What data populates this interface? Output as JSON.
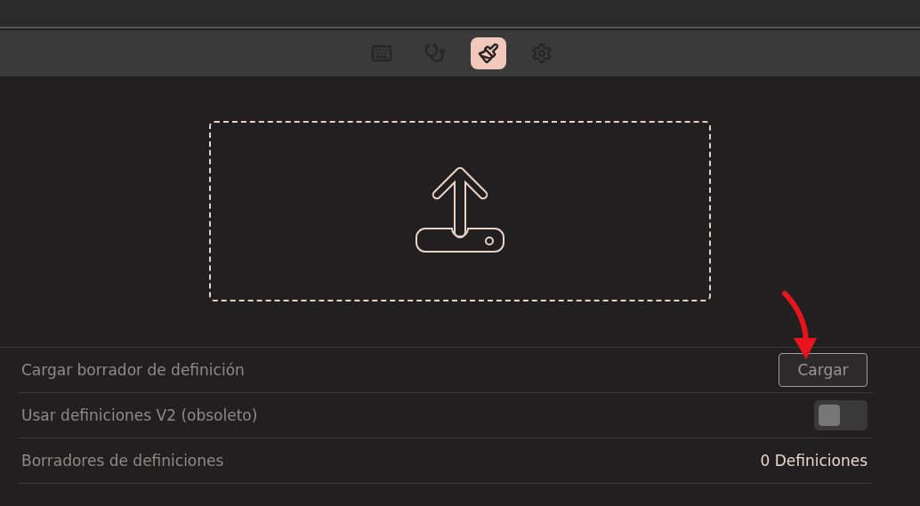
{
  "toolbar": {
    "tabs": [
      {
        "kind": "keyboard",
        "selected": false
      },
      {
        "kind": "stethoscope",
        "selected": false
      },
      {
        "kind": "brush",
        "selected": true
      },
      {
        "kind": "gear",
        "selected": false
      }
    ]
  },
  "dropzone": {
    "kind": "upload"
  },
  "settings": [
    {
      "kind": "button",
      "label": "Cargar borrador de definición",
      "button": "Cargar"
    },
    {
      "kind": "toggle",
      "label": "Usar definiciones V2 (obsoleto)",
      "on": false
    },
    {
      "kind": "value",
      "label": "Borradores de definiciones",
      "value": "0 Definiciones"
    }
  ],
  "annotation": {
    "kind": "arrow"
  }
}
